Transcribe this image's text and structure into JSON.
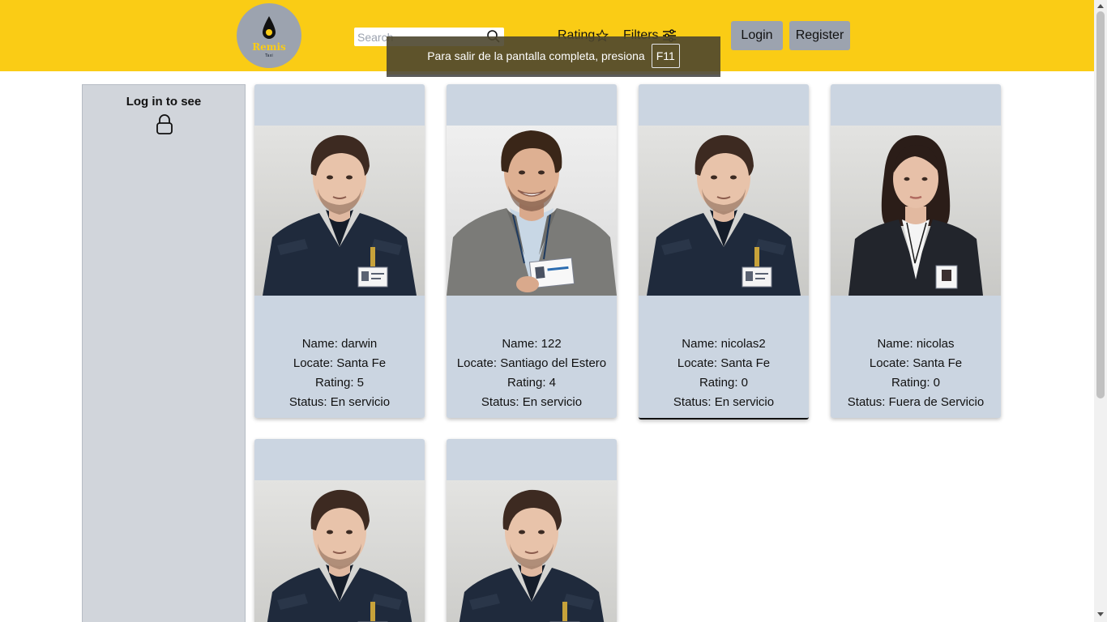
{
  "header": {
    "logo": {
      "text": "Remis",
      "subtext": "Taxi"
    },
    "search": {
      "placeholder": "Search",
      "value": ""
    },
    "nav": {
      "rating": "Rating",
      "filters": "Filters"
    },
    "buttons": {
      "login": "Login",
      "register": "Register"
    }
  },
  "toast": {
    "text": "Para salir de la pantalla completa, presiona",
    "key": "F11"
  },
  "sidebar": {
    "title": "Log in to see"
  },
  "cards": [
    {
      "name": "Name: darwin",
      "locate": "Locate: Santa Fe",
      "rating": "Rating: 5",
      "status": "Status: En servicio"
    },
    {
      "name": "Name: 122",
      "locate": "Locate: Santiago del Estero",
      "rating": "Rating: 4",
      "status": "Status: En servicio"
    },
    {
      "name": "Name: nicolas2",
      "locate": "Locate: Santa Fe",
      "rating": "Rating: 0",
      "status": "Status: En servicio"
    },
    {
      "name": "Name: nicolas",
      "locate": "Locate: Santa Fe",
      "rating": "Rating: 0",
      "status": "Status: Fuera de Servicio"
    },
    {
      "name": "",
      "locate": "",
      "rating": "",
      "status": ""
    },
    {
      "name": "",
      "locate": "",
      "rating": "",
      "status": ""
    }
  ],
  "colors": {
    "header": "#facc15",
    "card": "#cbd5e1",
    "sidebar": "#d1d5db",
    "button": "#9ca3af"
  },
  "icons": {
    "search": "search-icon",
    "rating": "star-icon",
    "filters": "sliders-icon",
    "lock": "lock-icon"
  }
}
